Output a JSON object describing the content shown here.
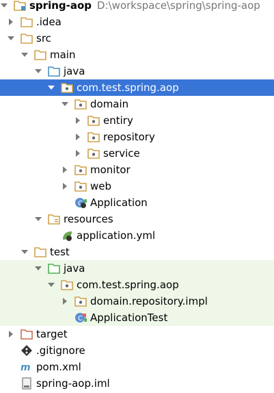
{
  "project": {
    "name": "spring-aop",
    "path": "D:\\workspace\\spring\\spring-aop"
  },
  "tree": {
    "idea": ".idea",
    "src": "src",
    "main": "main",
    "main_java": "java",
    "package": "com.test.spring.aop",
    "domain": "domain",
    "entiry": "entiry",
    "repository": "repository",
    "service": "service",
    "monitor": "monitor",
    "web": "web",
    "application": "Application",
    "resources": "resources",
    "application_yml": "application.yml",
    "test": "test",
    "test_java": "java",
    "test_package": "com.test.spring.aop",
    "domain_repository_impl": "domain.repository.impl",
    "application_test": "ApplicationTest",
    "target": "target",
    "gitignore": ".gitignore",
    "pom": "pom.xml",
    "iml": "spring-aop.iml"
  },
  "colors": {
    "selection": "#3875d7",
    "test_background": "#eef7e8",
    "folder": "#cfa24b",
    "java_folder": "#4a90c2",
    "test_folder": "#4caf50",
    "target_folder": "#c96a4a"
  },
  "icons": {
    "project": "project-folder-icon",
    "folder": "folder-icon",
    "source": "source-folder-icon",
    "package": "package-icon",
    "resources": "resources-folder-icon",
    "test_source": "test-source-folder-icon",
    "excluded": "excluded-folder-icon",
    "spring_boot": "spring-boot-class-icon",
    "spring_yml": "spring-yml-icon",
    "git": "git-icon",
    "maven": "maven-icon",
    "iml": "iml-file-icon"
  }
}
